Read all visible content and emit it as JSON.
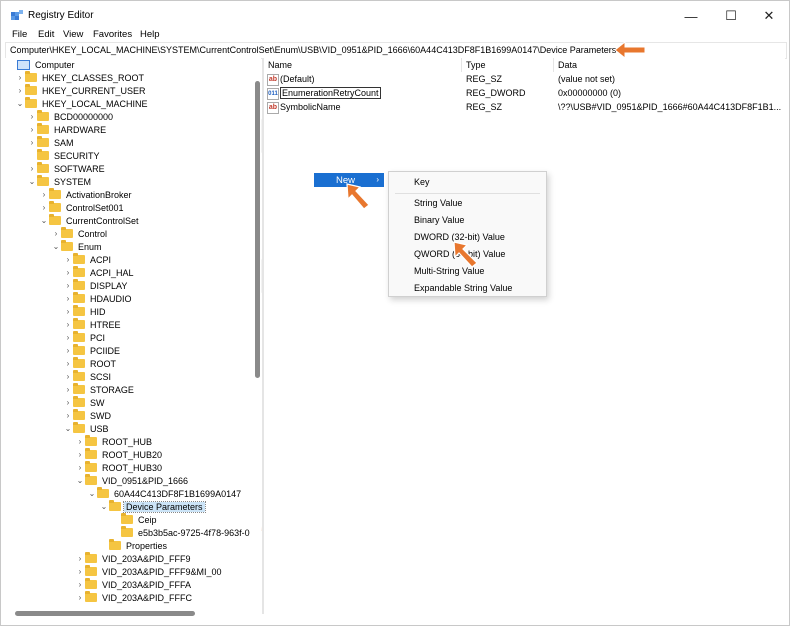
{
  "window": {
    "title": "Registry Editor",
    "minimize_glyph": "—",
    "maximize_glyph": "☐",
    "close_glyph": "✕"
  },
  "menu": [
    "File",
    "Edit",
    "View",
    "Favorites",
    "Help"
  ],
  "address": "Computer\\HKEY_LOCAL_MACHINE\\SYSTEM\\CurrentControlSet\\Enum\\USB\\VID_0951&PID_1666\\60A44C413DF8F1B1699A0147\\Device Parameters",
  "tree": [
    {
      "label": "Computer",
      "level": 0,
      "chev": "",
      "icon": "pc"
    },
    {
      "label": "HKEY_CLASSES_ROOT",
      "level": 1,
      "chev": "›",
      "icon": "folder"
    },
    {
      "label": "HKEY_CURRENT_USER",
      "level": 1,
      "chev": "›",
      "icon": "folder"
    },
    {
      "label": "HKEY_LOCAL_MACHINE",
      "level": 1,
      "chev": "⌄",
      "icon": "folder"
    },
    {
      "label": "BCD00000000",
      "level": 2,
      "chev": "›",
      "icon": "folder"
    },
    {
      "label": "HARDWARE",
      "level": 2,
      "chev": "›",
      "icon": "folder"
    },
    {
      "label": "SAM",
      "level": 2,
      "chev": "›",
      "icon": "folder"
    },
    {
      "label": "SECURITY",
      "level": 2,
      "chev": "",
      "icon": "folder"
    },
    {
      "label": "SOFTWARE",
      "level": 2,
      "chev": "›",
      "icon": "folder"
    },
    {
      "label": "SYSTEM",
      "level": 2,
      "chev": "⌄",
      "icon": "folder"
    },
    {
      "label": "ActivationBroker",
      "level": 3,
      "chev": "›",
      "icon": "folder"
    },
    {
      "label": "ControlSet001",
      "level": 3,
      "chev": "›",
      "icon": "folder"
    },
    {
      "label": "CurrentControlSet",
      "level": 3,
      "chev": "⌄",
      "icon": "folder"
    },
    {
      "label": "Control",
      "level": 4,
      "chev": "›",
      "icon": "folder"
    },
    {
      "label": "Enum",
      "level": 4,
      "chev": "⌄",
      "icon": "folder"
    },
    {
      "label": "ACPI",
      "level": 5,
      "chev": "›",
      "icon": "folder"
    },
    {
      "label": "ACPI_HAL",
      "level": 5,
      "chev": "›",
      "icon": "folder"
    },
    {
      "label": "DISPLAY",
      "level": 5,
      "chev": "›",
      "icon": "folder"
    },
    {
      "label": "HDAUDIO",
      "level": 5,
      "chev": "›",
      "icon": "folder"
    },
    {
      "label": "HID",
      "level": 5,
      "chev": "›",
      "icon": "folder"
    },
    {
      "label": "HTREE",
      "level": 5,
      "chev": "›",
      "icon": "folder"
    },
    {
      "label": "PCI",
      "level": 5,
      "chev": "›",
      "icon": "folder"
    },
    {
      "label": "PCIIDE",
      "level": 5,
      "chev": "›",
      "icon": "folder"
    },
    {
      "label": "ROOT",
      "level": 5,
      "chev": "›",
      "icon": "folder"
    },
    {
      "label": "SCSI",
      "level": 5,
      "chev": "›",
      "icon": "folder"
    },
    {
      "label": "STORAGE",
      "level": 5,
      "chev": "›",
      "icon": "folder"
    },
    {
      "label": "SW",
      "level": 5,
      "chev": "›",
      "icon": "folder"
    },
    {
      "label": "SWD",
      "level": 5,
      "chev": "›",
      "icon": "folder"
    },
    {
      "label": "USB",
      "level": 5,
      "chev": "⌄",
      "icon": "folder"
    },
    {
      "label": "ROOT_HUB",
      "level": 6,
      "chev": "›",
      "icon": "folder"
    },
    {
      "label": "ROOT_HUB20",
      "level": 6,
      "chev": "›",
      "icon": "folder"
    },
    {
      "label": "ROOT_HUB30",
      "level": 6,
      "chev": "›",
      "icon": "folder"
    },
    {
      "label": "VID_0951&PID_1666",
      "level": 6,
      "chev": "⌄",
      "icon": "folder"
    },
    {
      "label": "60A44C413DF8F1B1699A0147",
      "level": 7,
      "chev": "⌄",
      "icon": "folder"
    },
    {
      "label": "Device Parameters",
      "level": 8,
      "chev": "⌄",
      "icon": "folder",
      "selected": true
    },
    {
      "label": "Ceip",
      "level": 9,
      "chev": "",
      "icon": "folder"
    },
    {
      "label": "e5b3b5ac-9725-4f78-963f-0",
      "level": 9,
      "chev": "",
      "icon": "folder"
    },
    {
      "label": "Properties",
      "level": 8,
      "chev": "",
      "icon": "folder"
    },
    {
      "label": "VID_203A&PID_FFF9",
      "level": 6,
      "chev": "›",
      "icon": "folder"
    },
    {
      "label": "VID_203A&PID_FFF9&MI_00",
      "level": 6,
      "chev": "›",
      "icon": "folder"
    },
    {
      "label": "VID_203A&PID_FFFA",
      "level": 6,
      "chev": "›",
      "icon": "folder"
    },
    {
      "label": "VID_203A&PID_FFFC",
      "level": 6,
      "chev": "›",
      "icon": "folder"
    }
  ],
  "columns": {
    "name": "Name",
    "type": "Type",
    "data": "Data"
  },
  "values": [
    {
      "name": "(Default)",
      "type": "REG_SZ",
      "data": "(value not set)",
      "icon": "ab",
      "renaming": false
    },
    {
      "name": "EnumerationRetryCount",
      "type": "REG_DWORD",
      "data": "0x00000000 (0)",
      "icon": "011",
      "renaming": true
    },
    {
      "name": "SymbolicName",
      "type": "REG_SZ",
      "data": "\\??\\USB#VID_0951&PID_1666#60A44C413DF8F1B1...",
      "icon": "ab",
      "renaming": false
    }
  ],
  "context_menu": {
    "new_label": "New",
    "new_arrow": "›"
  },
  "submenu": {
    "key": "Key",
    "items": [
      "String Value",
      "Binary Value",
      "DWORD (32-bit) Value",
      "QWORD (64-bit) Value",
      "Multi-String Value",
      "Expandable String Value"
    ]
  },
  "colors": {
    "accent": "#1a6fd1",
    "pointer": "#e8772e",
    "folder": "#f5c542",
    "selection": "#cce4f7"
  }
}
